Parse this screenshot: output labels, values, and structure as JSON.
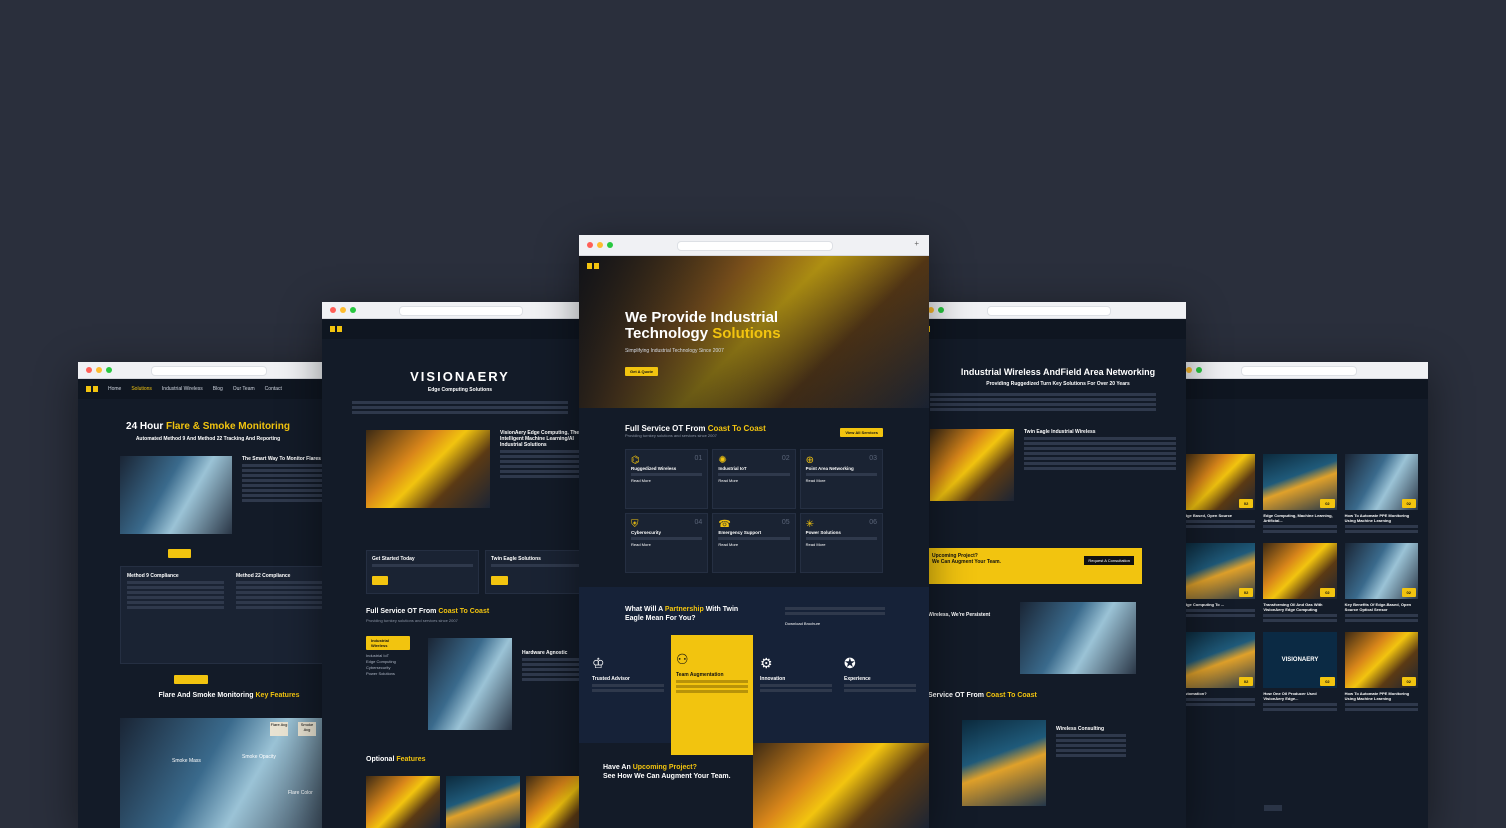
{
  "colors": {
    "background": "#2a2f3c",
    "accent": "#f2c40f",
    "site_bg": "#131b28"
  },
  "w1": {
    "nav": [
      "Home",
      "Solutions",
      "Industrial Wireless",
      "Blog",
      "Our Team",
      "Contact"
    ],
    "title_pre": "24 Hour ",
    "title_hl": "Flare & Smoke Monitoring",
    "subtitle": "Automated Method 9 And Method 22 Tracking And Reporting",
    "side_title": "The Smart Way To Monitor Flares",
    "m9": "Method 9 Compliance",
    "m22": "Method 22 Compliance",
    "kf_pre": "Flare And Smoke Monitoring ",
    "kf_hl": "Key Features",
    "lbl_smoke": "Smoke Mass",
    "lbl_opacity": "Smoke Opacity",
    "lbl_color": "Flare Color",
    "btn_a": "Flare Avg",
    "btn_b": "Smoke Avg"
  },
  "w2": {
    "logo": "VISIONAERY",
    "tag": "Edge Computing Solutions",
    "feature": "VisionAery Edge Computing, The Intelligent Machine Learning/AI Industrial Solutions",
    "gst": "Get Started Today",
    "te": "Twin Eagle Solutions",
    "fs_pre": "Full Service OT From ",
    "fs_hl": "Coast To Coast",
    "fs_sub": "Providing turnkey solutions and services since 2007",
    "hw": "Hardware Agnostic",
    "tabs": [
      "Industrial Wireless",
      "Industrial IoT",
      "Edge Computing",
      "Cybersecurity",
      "Power Solutions"
    ],
    "opt_pre": "Optional ",
    "opt_hl": "Features"
  },
  "w3": {
    "hero_l1": "We Provide Industrial",
    "hero_l2a": "Technology ",
    "hero_l2b": "Solutions",
    "hero_sub": "Simplifying Industrial Technology Since 2007",
    "hero_btn": "Get A Quote",
    "fs_pre": "Full Service OT From ",
    "fs_hl": "Coast To Coast",
    "fs_sub": "Providing turnkey solutions and services since 2007",
    "fs_btn": "View All Services",
    "services": [
      {
        "name": "Ruggedized Wireless",
        "num": "01",
        "icon": "wireless-icon"
      },
      {
        "name": "Industrial IoT",
        "num": "02",
        "icon": "iot-icon"
      },
      {
        "name": "Point Area Networking",
        "num": "03",
        "icon": "network-icon"
      },
      {
        "name": "Cybersecurity",
        "num": "04",
        "icon": "shield-icon"
      },
      {
        "name": "Emergency Support",
        "num": "05",
        "icon": "support-icon"
      },
      {
        "name": "Power Solutions",
        "num": "06",
        "icon": "power-icon"
      }
    ],
    "read_more": "Read More",
    "pt_a": "What Will A ",
    "pt_hl": "Partnership",
    "pt_b": " With Twin Eagle Mean For You?",
    "pt_link": "Download Brochure",
    "values": [
      "Trusted Advisor",
      "Team Augmentation",
      "Innovation",
      "Experience"
    ],
    "up_a": "Have An ",
    "up_hl": "Upcoming Project?",
    "up_b": "See How We Can Augment Your Team."
  },
  "w4": {
    "title": "Industrial Wireless AndField Area Networking",
    "sub": "Providing Ruggedized Turn Key Solutions For Over 20 Years",
    "twi": "Twin Eagle Industrial Wireless",
    "banner_a": "Upcoming Project?",
    "banner_b": "We Can Augment Your Team.",
    "banner_btn": "Request A Consultation",
    "persist": "Wireless, We're Persistent",
    "fs_pre": "Service OT From ",
    "fs_hl": "Coast To Coast",
    "wc": "Wireless Consulting"
  },
  "w5": {
    "posts": [
      {
        "title": "Edge Based, Open Source",
        "num": "02"
      },
      {
        "title": "Edge Computing, Machine Learning, Artificial...",
        "num": "02"
      },
      {
        "title": "How To Automate PPE Monitoring Using Machine Learning",
        "num": "02"
      },
      {
        "title": "Edge Computing To ...",
        "num": "02"
      },
      {
        "title": "Transforming Oil And Gas With VisionAery Edge Computing",
        "num": "02"
      },
      {
        "title": "Key Benefits Of Edge-Based, Open Source Optical Sensor",
        "num": "02"
      },
      {
        "title": "Automation?",
        "num": "02"
      },
      {
        "title": "How One Oil Producer Used VisionAery Edge...",
        "num": "02"
      },
      {
        "title": "How To Automate PPE Monitoring Using Machine Learning",
        "num": "02"
      }
    ],
    "vis": "VISIONAERY"
  }
}
